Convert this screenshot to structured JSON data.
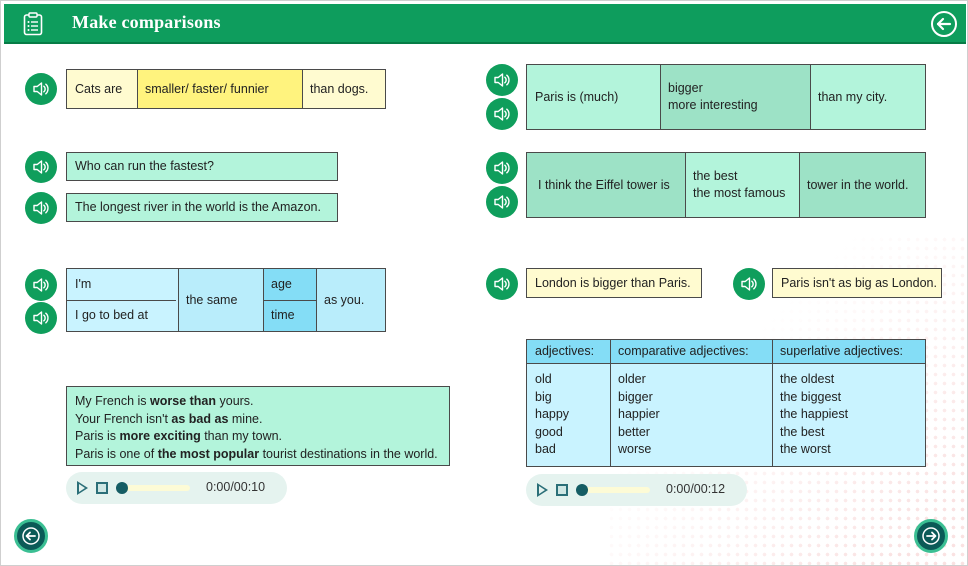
{
  "header": {
    "title": "Make comparisons"
  },
  "row1": {
    "c1": "Cats are",
    "c2": "smaller/ faster/ funnier",
    "c3": "than dogs."
  },
  "q1": "Who can run the fastest?",
  "q2": "The longest river in the world is the Amazon.",
  "same": {
    "r1": "I'm",
    "r2": "I go to bed at",
    "mid": "the same",
    "a1": "age",
    "a2": "time",
    "end": "as you."
  },
  "examples": {
    "l1": {
      "a": "My French is ",
      "b": "worse than",
      "c": " yours."
    },
    "l2": {
      "a": "Your French isn't ",
      "b": "as bad as",
      "c": " mine."
    },
    "l3": {
      "a": "Paris is ",
      "b": "more exciting",
      "c": " than my town."
    },
    "l4": {
      "a": "Paris is one of ",
      "b": "the most popular",
      "c": " tourist destinations in the world."
    }
  },
  "player1": {
    "time": "0:00/00:10",
    "progress": 0
  },
  "paris": {
    "c1": "Paris is (much)",
    "c2a": "bigger",
    "c2b": "more interesting",
    "c3": "than my city."
  },
  "eiffel": {
    "c1": "I think the Eiffel tower is",
    "c2a": "the best",
    "c2b": "the most famous",
    "c3": "tower in the world."
  },
  "london": {
    "a": "London is bigger than Paris.",
    "b": "Paris isn't as big as London."
  },
  "adjectives": {
    "headers": [
      "adjectives:",
      "comparative adjectives:",
      "superlative adjectives:"
    ],
    "col1": [
      "old",
      "big",
      "happy",
      "good",
      "bad"
    ],
    "col2": [
      "older",
      "bigger",
      "happier",
      "better",
      "worse"
    ],
    "col3": [
      "the oldest",
      "the biggest",
      "the happiest",
      "the best",
      "the worst"
    ]
  },
  "player2": {
    "time": "0:00/00:12",
    "progress": 0
  },
  "icons": {
    "speaker": "speaker-icon",
    "header": "clipboard-list-icon",
    "back": "arrow-left-icon",
    "prev": "arrow-left-icon",
    "next": "arrow-right-icon"
  },
  "colors": {
    "header": "#0e9d5d",
    "speaker": "#0f9e5c",
    "nav": "#0b5a57",
    "yellow": "#fff37e",
    "mint": "#b3f4db",
    "sky": "#84ddf6"
  }
}
